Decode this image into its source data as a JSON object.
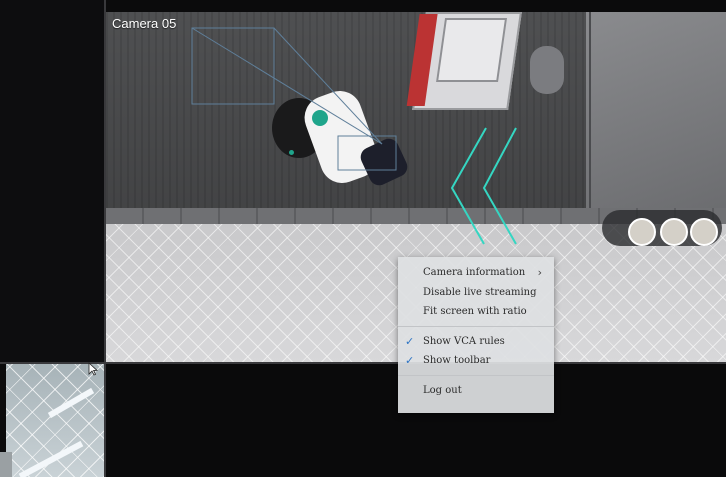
{
  "camera": {
    "label": "Camera 05"
  },
  "context_menu": {
    "items": [
      {
        "label": "Camera information",
        "has_submenu": true,
        "submenu_icon": "chevron-right-icon"
      },
      {
        "label": "Disable live streaming"
      },
      {
        "label": "Fit screen with ratio"
      },
      {
        "label": "Show VCA rules",
        "checked": true,
        "check_icon": "checkmark-icon"
      },
      {
        "label": "Show toolbar",
        "checked": true,
        "check_icon": "checkmark-icon"
      },
      {
        "label": "Log out"
      }
    ]
  },
  "colors": {
    "vca_rule": "#35d6c2",
    "check": "#2d74c4",
    "menu_bg": "#dee0e2"
  }
}
